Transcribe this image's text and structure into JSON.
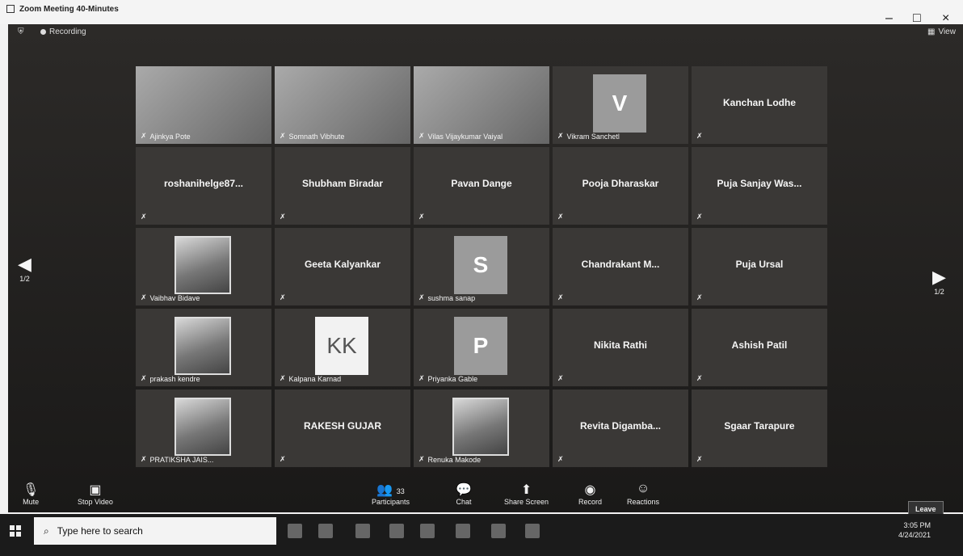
{
  "window": {
    "title": "Zoom Meeting 40-Minutes",
    "minimize": "–",
    "restore": "□",
    "close": "×"
  },
  "topbar": {
    "recording": "Recording",
    "view": "View"
  },
  "nav": {
    "left_page": "1/2",
    "right_page": "1/2"
  },
  "participants": [
    {
      "name": "Ajinkya Pote",
      "type": "video"
    },
    {
      "name": "Somnath Vibhute",
      "type": "video"
    },
    {
      "name": "Vilas Vijaykumar Vaiyal",
      "type": "video"
    },
    {
      "name": "Vikram Sanchetl",
      "type": "avatar",
      "initial": "V"
    },
    {
      "name": "Kanchan Lodhe",
      "type": "name"
    },
    {
      "name": "roshanihelge87...",
      "type": "name"
    },
    {
      "name": "Shubham Biradar",
      "type": "name"
    },
    {
      "name": "Pavan Dange",
      "type": "name"
    },
    {
      "name": "Pooja Dharaskar",
      "type": "name"
    },
    {
      "name": "Puja Sanjay Was...",
      "type": "name"
    },
    {
      "name": "Vaibhav Bidave",
      "type": "photo"
    },
    {
      "name": "Geeta Kalyankar",
      "type": "name"
    },
    {
      "name": "sushma sanap",
      "type": "avatar",
      "initial": "S"
    },
    {
      "name": "Chandrakant M...",
      "type": "name"
    },
    {
      "name": "Puja Ursal",
      "type": "name"
    },
    {
      "name": "prakash kendre",
      "type": "photo"
    },
    {
      "name": "Kalpana Karnad",
      "type": "avatar-white",
      "initial": "KK"
    },
    {
      "name": "Priyanka Gable",
      "type": "avatar",
      "initial": "P"
    },
    {
      "name": "Nikita Rathi",
      "type": "name"
    },
    {
      "name": "Ashish Patil",
      "type": "name"
    },
    {
      "name": "PRATIKSHA JAIS...",
      "type": "photo"
    },
    {
      "name": "RAKESH GUJAR",
      "type": "name"
    },
    {
      "name": "Renuka Makode",
      "type": "photo"
    },
    {
      "name": "Revita Digamba...",
      "type": "name"
    },
    {
      "name": "Sgaar Tarapure",
      "type": "name"
    }
  ],
  "controls": {
    "mute": "Mute",
    "stop_video": "Stop Video",
    "participants": "Participants",
    "participants_count": "33",
    "chat": "Chat",
    "share_screen": "Share Screen",
    "record": "Record",
    "reactions": "Reactions",
    "leave": "Leave"
  },
  "taskbar": {
    "search_placeholder": "Type here to search",
    "time": "3:05 PM",
    "date": "4/24/2021"
  }
}
